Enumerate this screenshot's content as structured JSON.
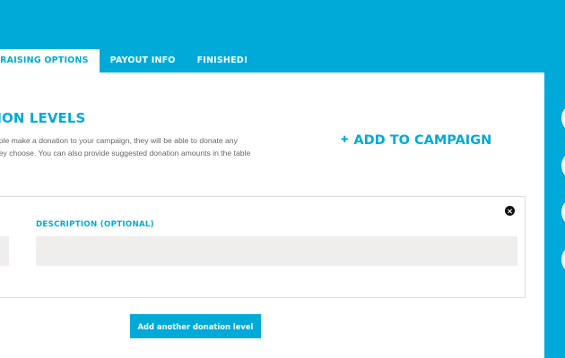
{
  "tabs": [
    {
      "label": "DRAISING OPTIONS",
      "active": true
    },
    {
      "label": "PAYOUT INFO",
      "active": false
    },
    {
      "label": "FINISHED!",
      "active": false
    }
  ],
  "section": {
    "title": "TION LEVELS",
    "helper_lines": [
      "ople make a donation to your campaign, they will be able to donate any",
      "hey choose. You can also provide suggested donation amounts in the table"
    ],
    "add_to_campaign": "ADD TO CAMPAIGN",
    "add_to_campaign_icon": "plus-icon"
  },
  "level": {
    "description_label": "DESCRIPTION (OPTIONAL)",
    "description_value": "",
    "remove_icon": "close-circle-icon"
  },
  "add_level_button": "Add another donation level",
  "colors": {
    "accent": "#00aad8",
    "input_bg": "#efeeec",
    "panel_bg": "#ffffff"
  }
}
